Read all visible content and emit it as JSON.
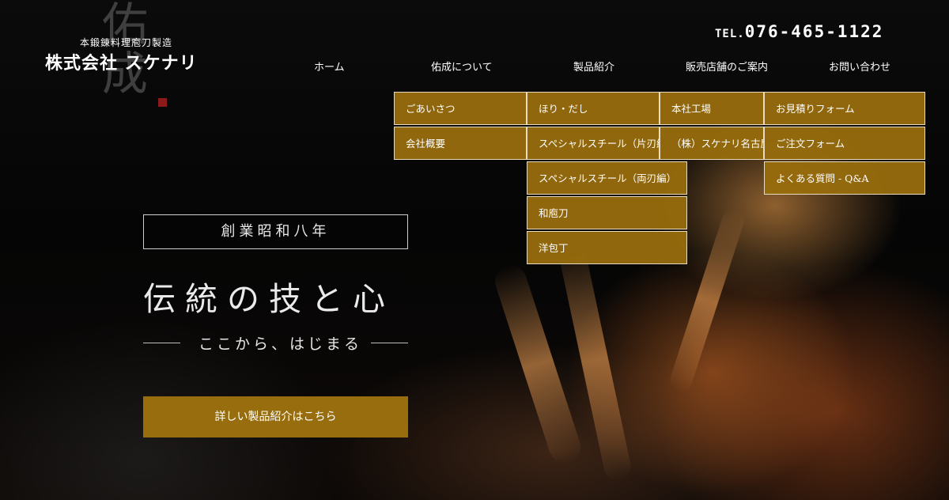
{
  "header": {
    "logo_kanji": "佑成",
    "tagline": "本鍛錬料理庖刀製造",
    "company": "株式会社 スケナリ",
    "tel_prefix": "TEL.",
    "tel_number": "076-465-1122"
  },
  "nav": {
    "items": [
      {
        "label": "ホーム"
      },
      {
        "label": "佑成について"
      },
      {
        "label": "製品紹介"
      },
      {
        "label": "販売店舗のご案内"
      },
      {
        "label": "お問い合わせ"
      }
    ],
    "submenus": {
      "about": [
        "ごあいさつ",
        "会社概要"
      ],
      "products": [
        "ほり・だし",
        "スペシャルスチール（片刃編",
        "スペシャルスチール（両刃編）",
        "和庖刀",
        "洋包丁"
      ],
      "stores": [
        "本社工場",
        "（株）スケナリ名古屋店"
      ],
      "contact": [
        "お見積りフォーム",
        "ご注文フォーム",
        "よくある質問 - Q&A"
      ]
    }
  },
  "hero": {
    "badge": "創業昭和八年",
    "title": "伝統の技と心",
    "subtitle": "ここから、はじまる",
    "cta_label": "詳しい製品紹介はこちら"
  },
  "colors": {
    "accent_gold": "#986d0d",
    "background": "#050505",
    "seal_red": "#8c1a1a"
  }
}
